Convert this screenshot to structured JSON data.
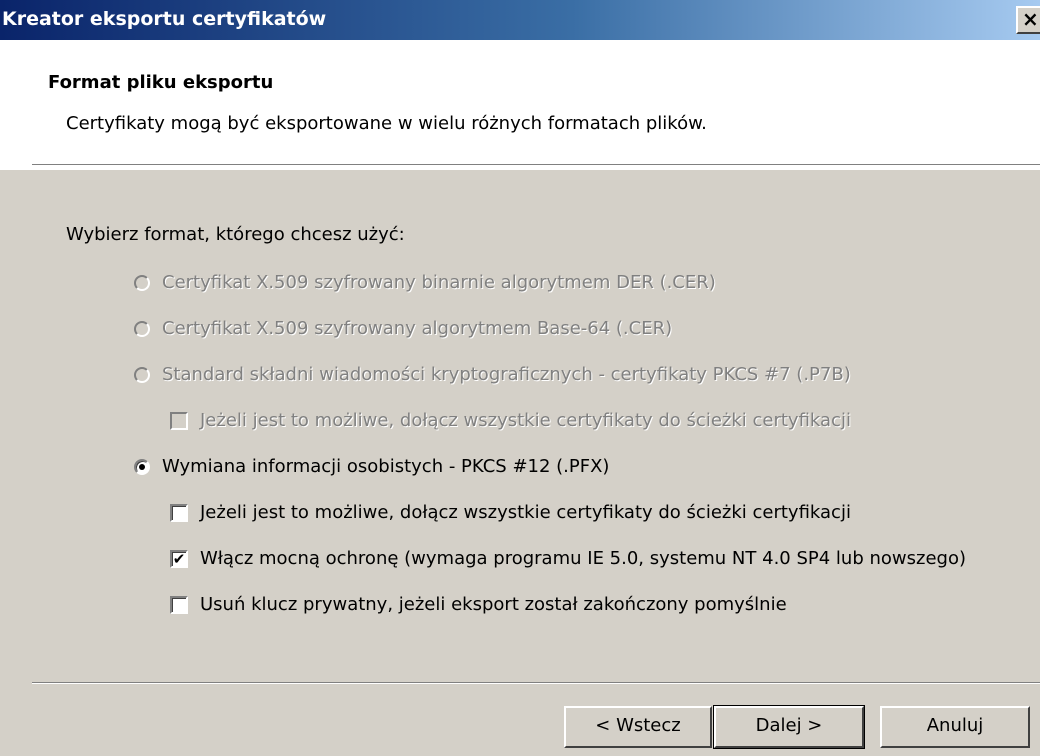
{
  "window": {
    "title": "Kreator eksportu certyfikatów",
    "close_glyph": "×"
  },
  "header": {
    "title": "Format pliku eksportu",
    "subtitle": "Certyfikaty mogą być eksportowane w wielu różnych formatach plików."
  },
  "prompt": "Wybierz format, którego chcesz użyć:",
  "options": [
    {
      "label": "Certyfikat X.509 szyfrowany binarnie algorytmem DER (.CER)",
      "selected": false,
      "enabled": false
    },
    {
      "label": "Certyfikat X.509 szyfrowany algorytmem Base-64 (.CER)",
      "selected": false,
      "enabled": false
    },
    {
      "label": "Standard składni wiadomości kryptograficznych - certyfikaty PKCS #7 (.P7B)",
      "selected": false,
      "enabled": false
    },
    {
      "label": "Wymiana informacji osobistych - PKCS #12 (.PFX)",
      "selected": true,
      "enabled": true
    }
  ],
  "checkboxes": [
    {
      "label": "Jeżeli jest to możliwe, dołącz wszystkie certyfikaty do ścieżki certyfikacji",
      "checked": false,
      "enabled": false
    },
    {
      "label": "Jeżeli jest to możliwe, dołącz wszystkie certyfikaty do ścieżki certyfikacji",
      "checked": false,
      "enabled": true
    },
    {
      "label": "Włącz mocną ochronę (wymaga programu IE 5.0, systemu NT 4.0 SP4 lub nowszego)",
      "checked": true,
      "enabled": true
    },
    {
      "label": "Usuń klucz prywatny, jeżeli eksport został zakończony pomyślnie",
      "checked": false,
      "enabled": true
    }
  ],
  "check_glyph": "✔",
  "buttons": {
    "back": "< Wstecz",
    "next": "Dalej >",
    "cancel": "Anuluj"
  }
}
